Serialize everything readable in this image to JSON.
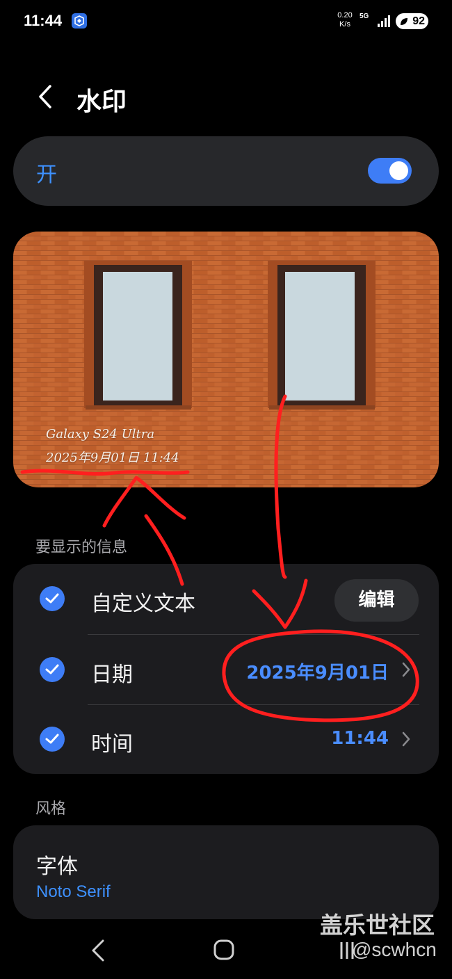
{
  "status_bar": {
    "time": "11:44",
    "net_speed_value": "0.20",
    "net_speed_unit": "K/s",
    "network_type": "5G",
    "battery": "92"
  },
  "header": {
    "title": "水印"
  },
  "master_toggle": {
    "label": "开",
    "on": true
  },
  "preview": {
    "watermark_line1": "Galaxy S24 Ultra",
    "watermark_line2": "2025年9月01日 11:44"
  },
  "info_section": {
    "heading": "要显示的信息",
    "rows": [
      {
        "label": "自定义文本",
        "checked": true,
        "button": "编辑"
      },
      {
        "label": "日期",
        "checked": true,
        "value": "2025年9月01日"
      },
      {
        "label": "时间",
        "checked": true,
        "value": "11:44"
      }
    ]
  },
  "style_section": {
    "heading": "风格",
    "font_label": "字体",
    "font_value": "Noto Serif"
  },
  "overlay_watermark": {
    "brand": "盖乐世社区",
    "user": "@scwhcn"
  },
  "colors": {
    "accent": "#3e7df6",
    "accent_text": "#4a8dff",
    "card_bg": "#1c1c1f",
    "annotation_red": "#ff1f1f",
    "brick": "#c4642f"
  }
}
